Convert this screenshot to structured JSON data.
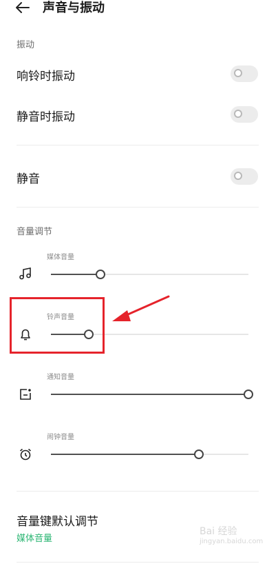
{
  "header": {
    "title": "声音与振动",
    "back_icon": "arrow-left-icon"
  },
  "vibration": {
    "section_title": "振动",
    "ring_vibrate": {
      "label": "响铃时振动",
      "on": false
    },
    "silent_vibrate": {
      "label": "静音时振动",
      "on": false
    }
  },
  "mute": {
    "label": "静音",
    "on": false
  },
  "volume": {
    "section_title": "音量调节",
    "sliders": [
      {
        "label": "媒体音量",
        "icon": "music-note-icon",
        "level": 0.25
      },
      {
        "label": "铃声音量",
        "icon": "bell-icon",
        "level": 0.19
      },
      {
        "label": "通知音量",
        "icon": "notification-icon",
        "level": 1.0
      },
      {
        "label": "闹钟音量",
        "icon": "alarm-clock-icon",
        "level": 0.75
      }
    ]
  },
  "volume_key": {
    "label": "音量键默认调节",
    "value": "媒体音量"
  },
  "annotation": {
    "highlight_color": "#e5232b",
    "arrow_color": "#e5232b"
  },
  "watermark": {
    "text": "Bai 经验",
    "sub": "jingyan.baidu.com"
  }
}
